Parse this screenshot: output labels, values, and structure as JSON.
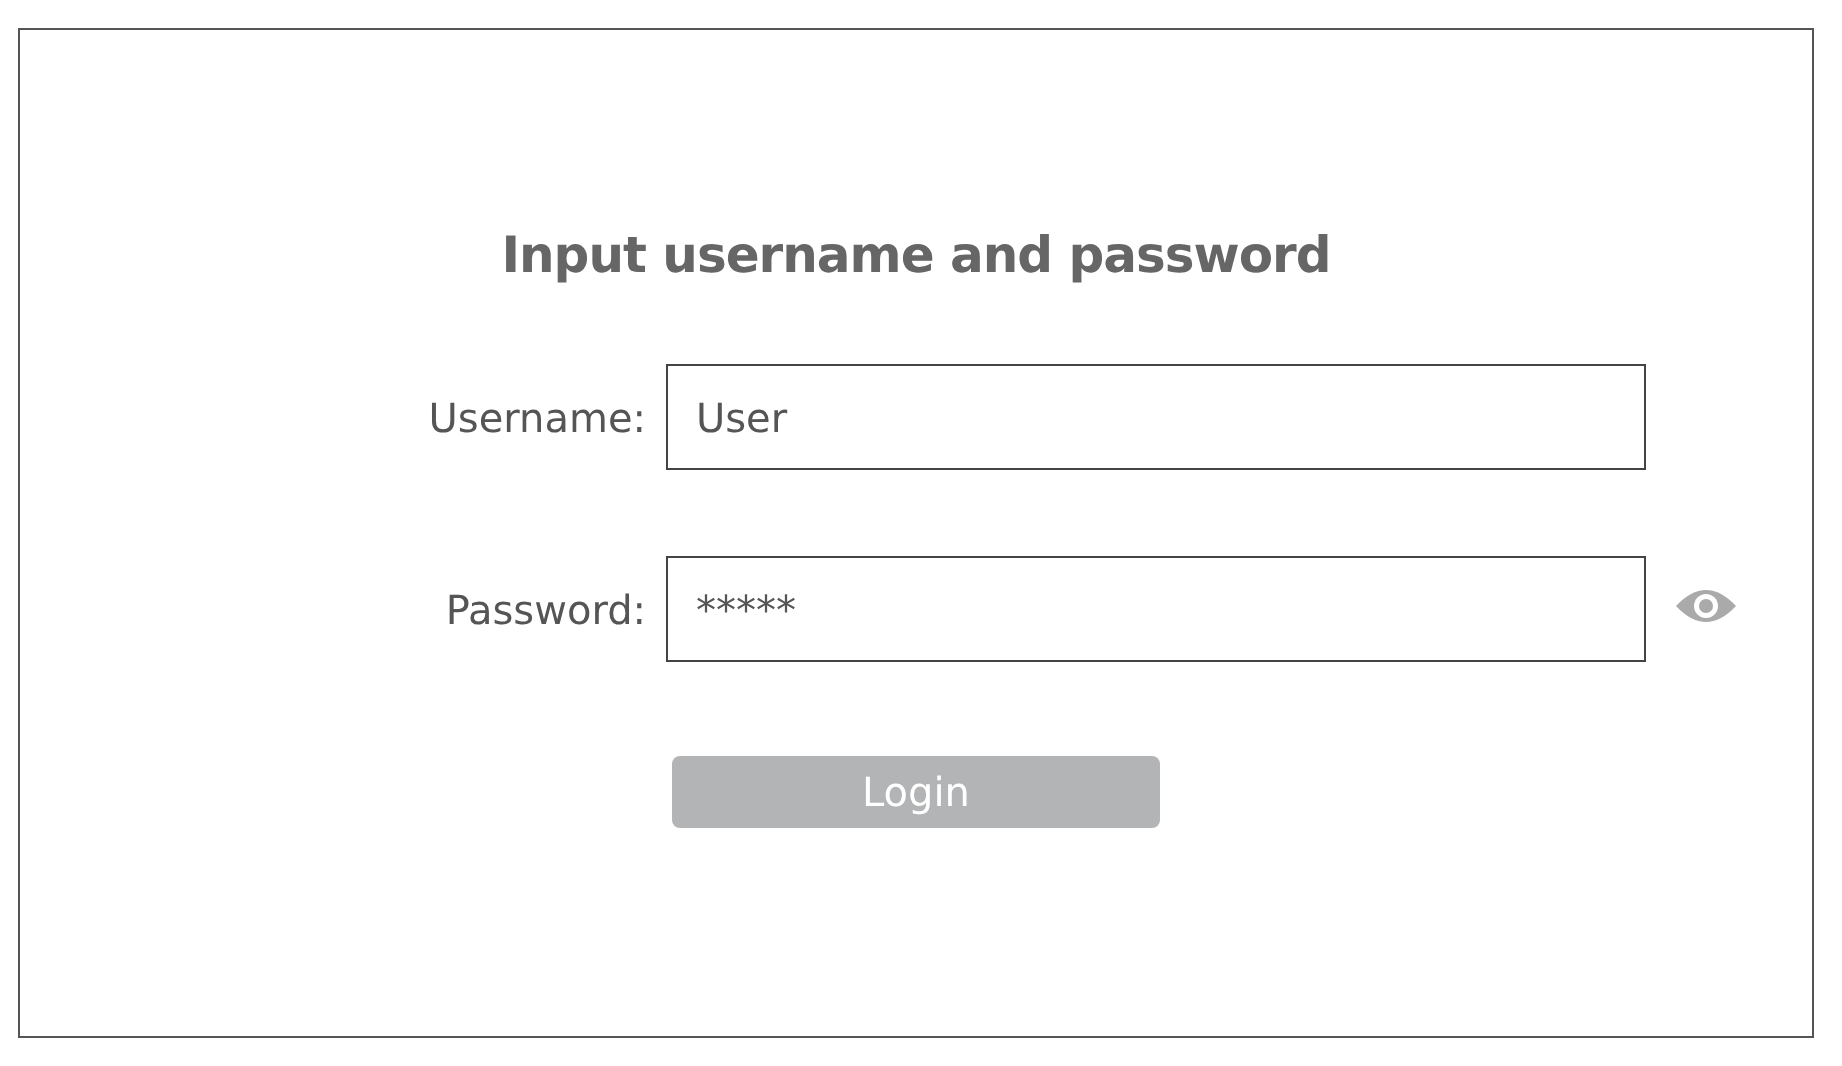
{
  "title": "Input username and password",
  "fields": [
    {
      "label": "Username:",
      "value": "User",
      "reveal_icon": false
    },
    {
      "label": "Password:",
      "value": "*****",
      "reveal_icon": true
    }
  ],
  "button": "Login"
}
